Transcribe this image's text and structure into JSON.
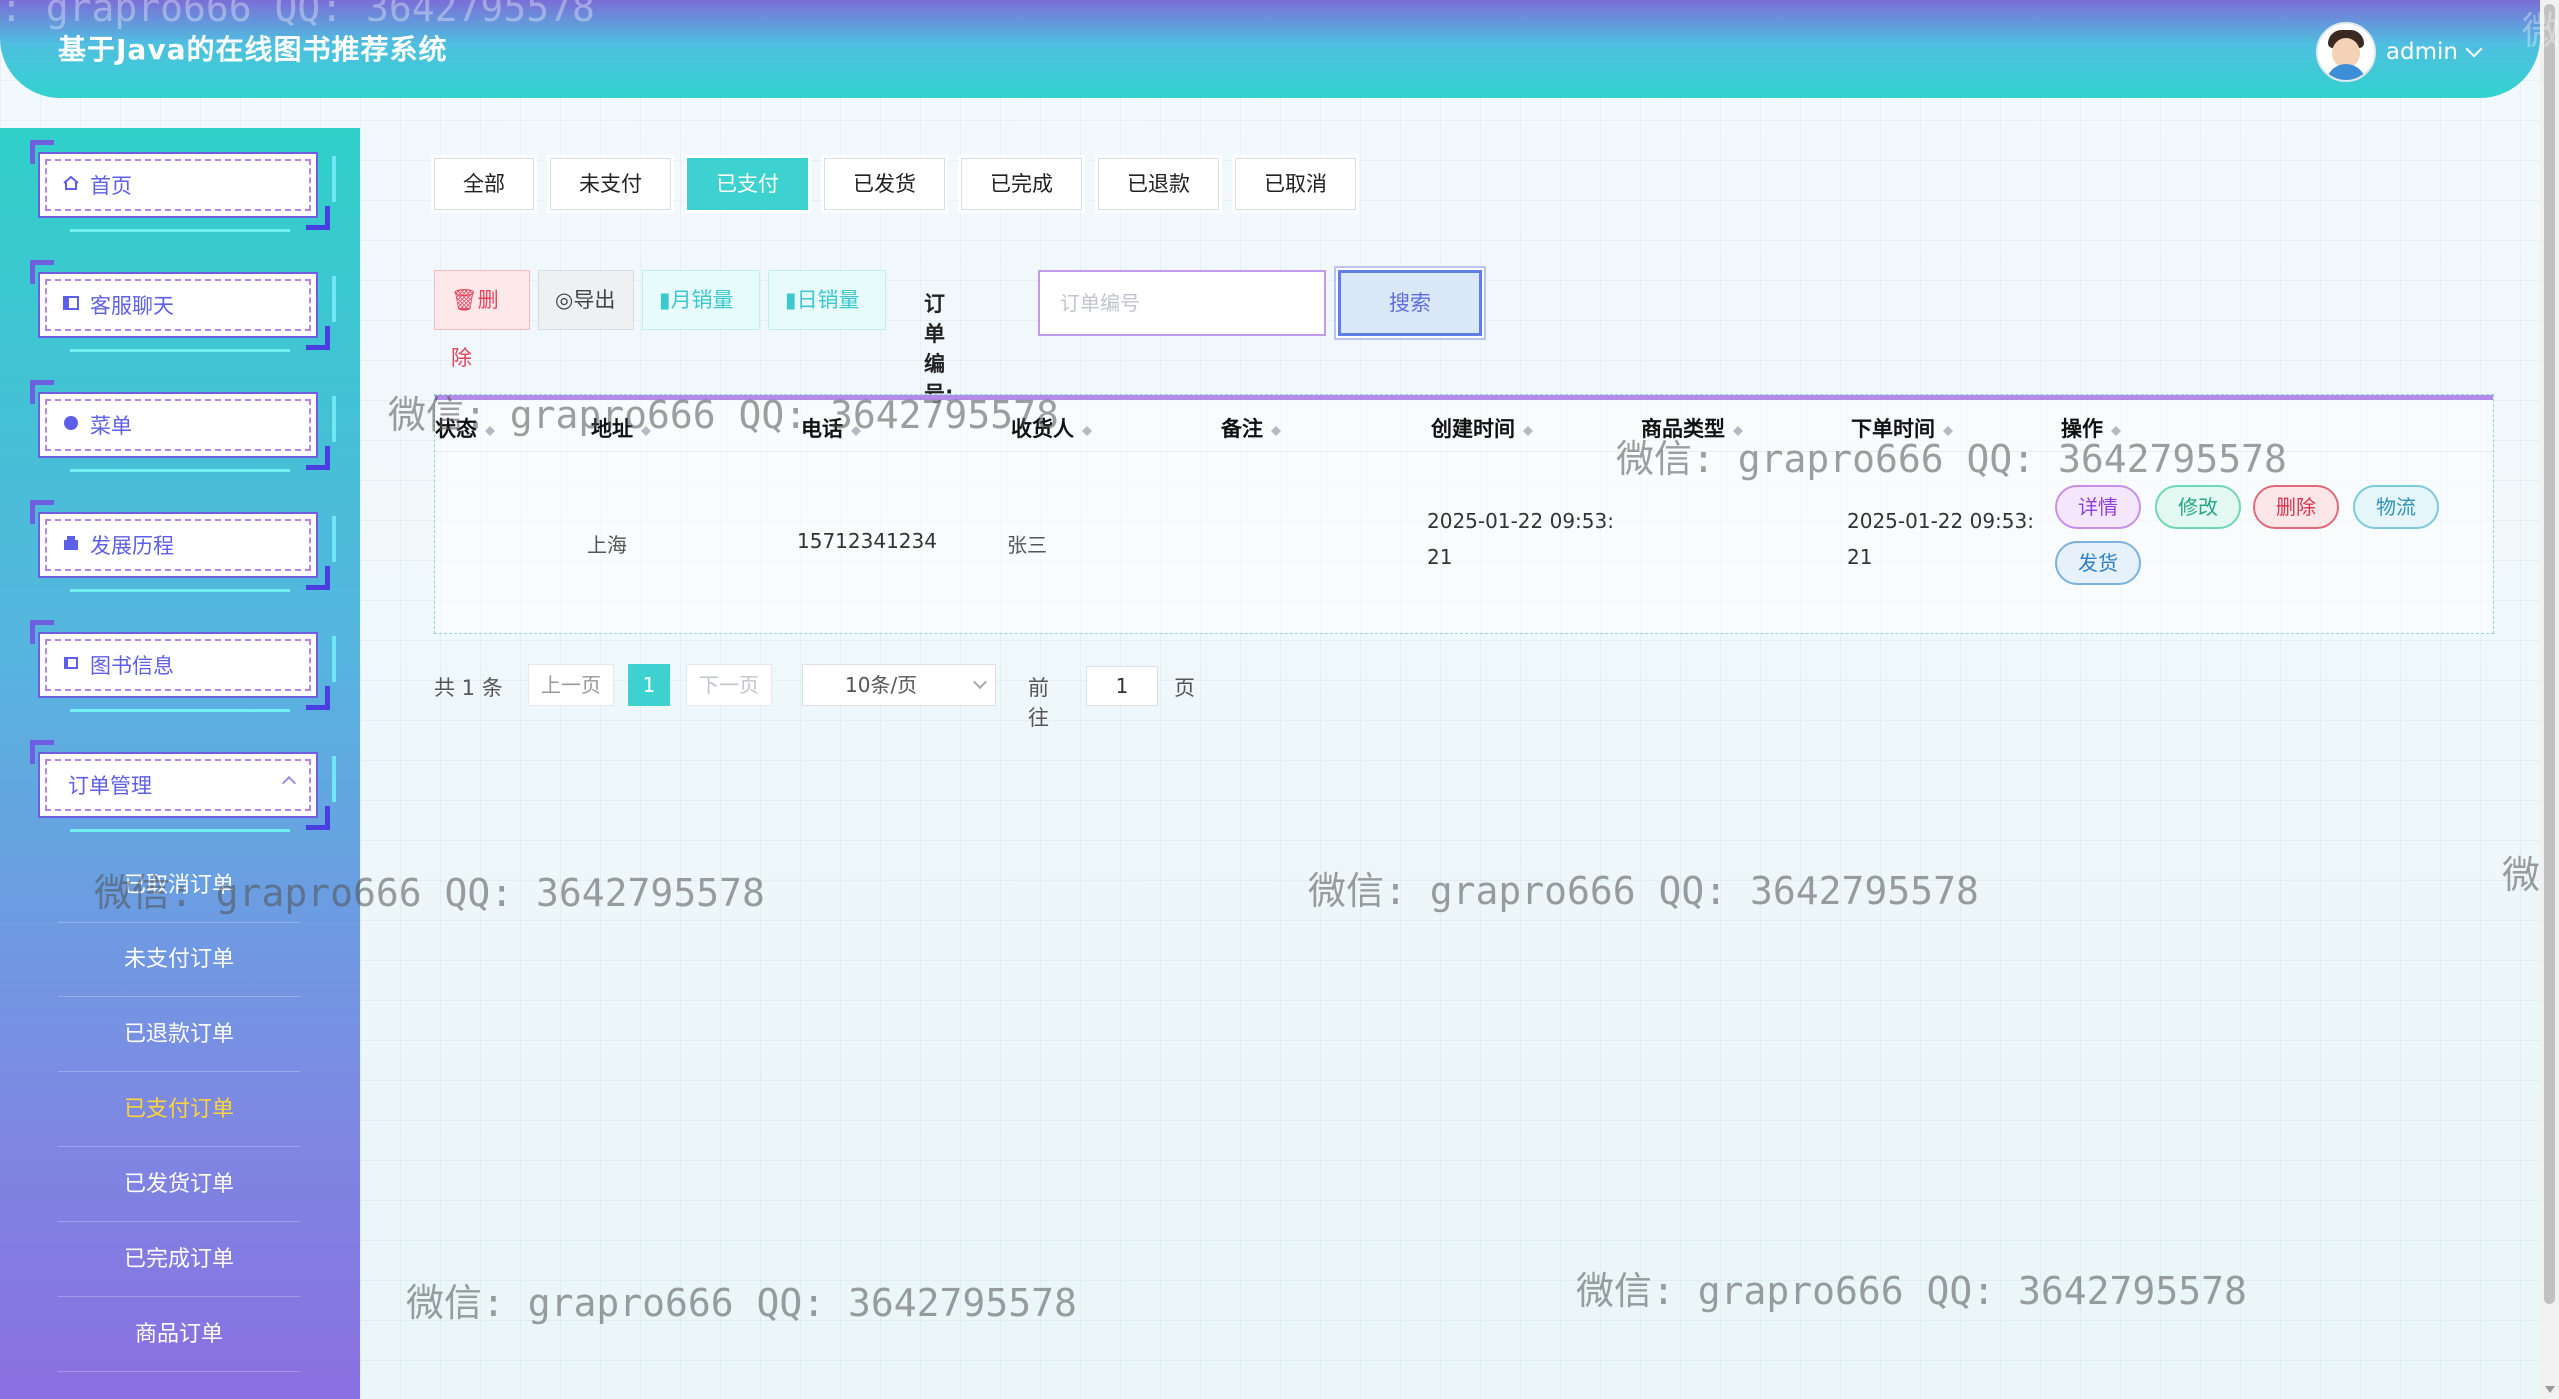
{
  "header": {
    "title": "基于Java的在线图书推荐系统",
    "username": "admin"
  },
  "sidebar": {
    "items": [
      {
        "label": "首页",
        "icon": "home-icon"
      },
      {
        "label": "客服聊天",
        "icon": "chat-icon"
      },
      {
        "label": "菜单",
        "icon": "menu-icon"
      },
      {
        "label": "发展历程",
        "icon": "history-icon"
      },
      {
        "label": "图书信息",
        "icon": "book-icon"
      },
      {
        "label": "订单管理",
        "icon": "order-icon"
      }
    ],
    "subitems": [
      {
        "label": "已取消订单"
      },
      {
        "label": "未支付订单"
      },
      {
        "label": "已退款订单"
      },
      {
        "label": "已支付订单",
        "active": true
      },
      {
        "label": "已发货订单"
      },
      {
        "label": "已完成订单"
      },
      {
        "label": "商品订单"
      }
    ]
  },
  "tabs": [
    "全部",
    "未支付",
    "已支付",
    "已发货",
    "已完成",
    "已退款",
    "已取消"
  ],
  "active_tab": "已支付",
  "toolbar": {
    "delete_label": "删除",
    "export_label": "导出",
    "monthly_label": "月销量",
    "daily_label": "日销量",
    "order_no_label": "订单编号:",
    "order_no_placeholder": "订单编号",
    "search_label": "搜索"
  },
  "table": {
    "columns": [
      "状态",
      "地址",
      "电话",
      "收货人",
      "备注",
      "创建时间",
      "商品类型",
      "下单时间",
      "操作"
    ],
    "rows": [
      {
        "status": "",
        "address": "上海",
        "phone": "15712341234",
        "receiver": "张三",
        "remark": "",
        "created_line1": "2025-01-22 09:53:",
        "created_line2": "21",
        "goods_type": "",
        "order_line1": "2025-01-22 09:53:",
        "order_line2": "21",
        "actions": [
          "详情",
          "修改",
          "删除",
          "物流",
          "发货"
        ]
      }
    ]
  },
  "pagination": {
    "total": "共 1 条",
    "prev": "上一页",
    "current": "1",
    "next": "下一页",
    "page_size": "10条/页",
    "goto": "前往",
    "goto_value": "1",
    "page_unit": "页"
  },
  "watermark": "微信: grapro666 QQ: 3642795578",
  "watermark_top": ": grapro666 QQ: 3642795578",
  "watermark_edge": "微",
  "colors": {
    "accent": "#3dd2cf",
    "active_sub": "#ffd43b",
    "header_from": "#7b6ed6",
    "header_to": "#32d3cf"
  }
}
